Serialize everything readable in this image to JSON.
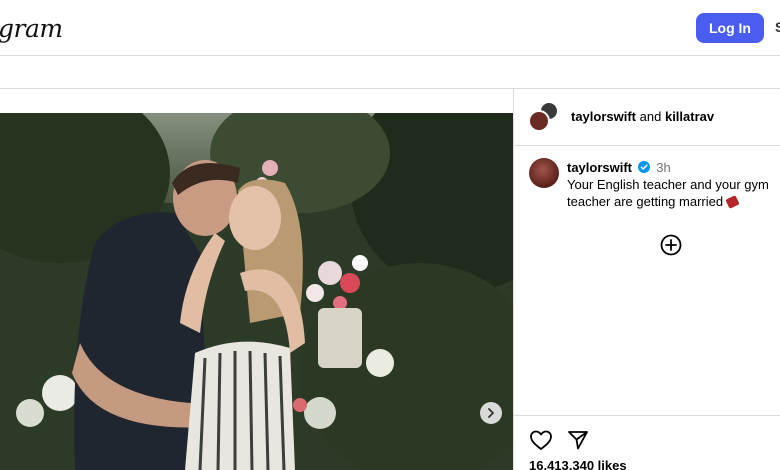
{
  "header": {
    "logo_text": "gram",
    "login_label": "Log In",
    "edge_text": "S"
  },
  "post": {
    "collab_user1": "taylorswift",
    "collab_and": "and",
    "collab_user2": "killatrav",
    "caption": {
      "username": "taylorswift",
      "time": "3h",
      "text": "Your English teacher and your gym teacher are getting married"
    },
    "likes": "16,413,340 likes"
  },
  "icons": {
    "verified": "verified-badge-icon",
    "next": "chevron-right-icon",
    "add": "plus-circle-icon",
    "like": "heart-icon",
    "share": "share-icon"
  },
  "colors": {
    "accent": "#4a5df0",
    "verified": "#0095f6",
    "muted": "#737373"
  }
}
